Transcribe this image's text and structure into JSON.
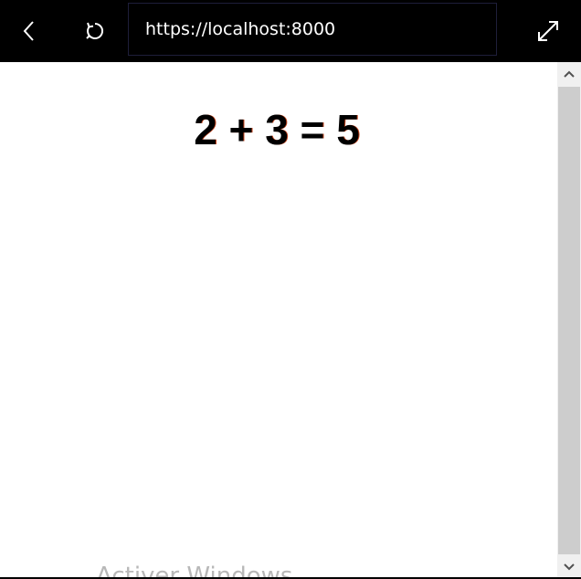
{
  "toolbar": {
    "back_icon": "chevron-left-icon",
    "reload_icon": "reload-icon",
    "expand_icon": "expand-icon",
    "url": "https://localhost:8000"
  },
  "page": {
    "equation": "2 + 3 = 5"
  },
  "overlay": {
    "watermark": "Activer Windows"
  },
  "scrollbar": {
    "up_icon": "chevron-up-icon",
    "down_icon": "chevron-down-icon",
    "position": 0
  },
  "colors": {
    "toolbar_bg": "#000000",
    "url_text": "#ffffff",
    "page_bg": "#ffffff",
    "scroll_track": "#f0f0f0",
    "scroll_thumb": "#cdcdcd"
  }
}
